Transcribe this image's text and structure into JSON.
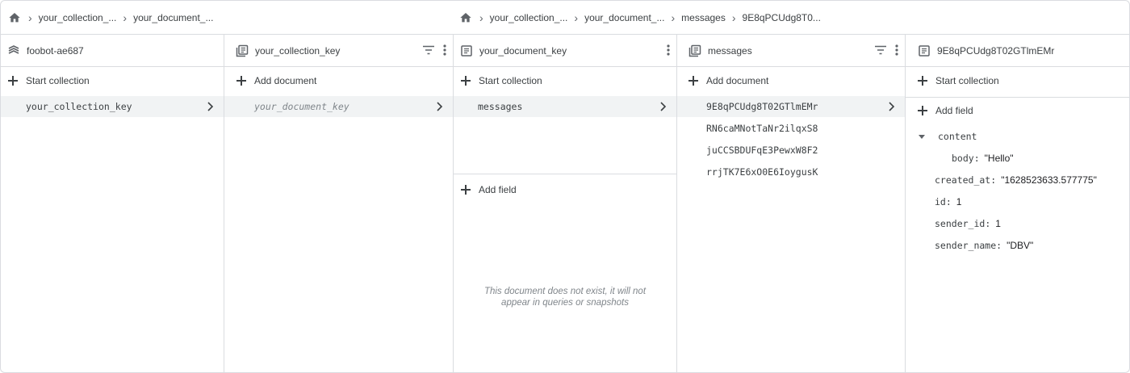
{
  "breadcrumbs_left": [
    "your_collection_...",
    "your_document_..."
  ],
  "breadcrumbs_right": [
    "your_collection_...",
    "your_document_...",
    "messages",
    "9E8qPCUdg8T0..."
  ],
  "panels": {
    "root": {
      "title": "foobot-ae687",
      "action": "Start collection",
      "items": [
        "your_collection_key"
      ]
    },
    "collection": {
      "title": "your_collection_key",
      "action": "Add document",
      "items": [
        "your_document_key"
      ]
    },
    "document": {
      "title": "your_document_key",
      "action": "Start collection",
      "items": [
        "messages"
      ],
      "add_field": "Add field",
      "note_line1": "This document does not exist, it will not",
      "note_line2": "appear in queries or snapshots"
    },
    "messages": {
      "title": "messages",
      "action": "Add document",
      "items": [
        "9E8qPCUdg8T02GTlmEMr",
        "RN6caMNotTaNr2ilqxS8",
        "juCCSBDUFqE3PewxW8F2",
        "rrjTK7E6xO0E6IoygusK"
      ]
    },
    "detail": {
      "title": "9E8qPCUdg8T02GTlmEMr",
      "action": "Start collection",
      "add_field": "Add field",
      "fields": [
        {
          "key": "content",
          "value": ""
        },
        {
          "key": "body",
          "value": "\"Hello\""
        },
        {
          "key": "created_at",
          "value": "\"1628523633.577775\""
        },
        {
          "key": "id",
          "value": "1"
        },
        {
          "key": "sender_id",
          "value": "1"
        },
        {
          "key": "sender_name",
          "value": "\"DBV\""
        }
      ]
    }
  },
  "icons": {
    "home": "home-icon",
    "project": "firebase-stack-icon",
    "collection": "collection-icon",
    "document": "document-icon",
    "filter": "filter-icon",
    "more": "more-vert-icon",
    "chevron": "chevron-right-icon"
  },
  "colors": {
    "border": "#dadce0",
    "selected_row": "#f1f3f4",
    "text": "#3c4043",
    "muted": "#80868b"
  }
}
